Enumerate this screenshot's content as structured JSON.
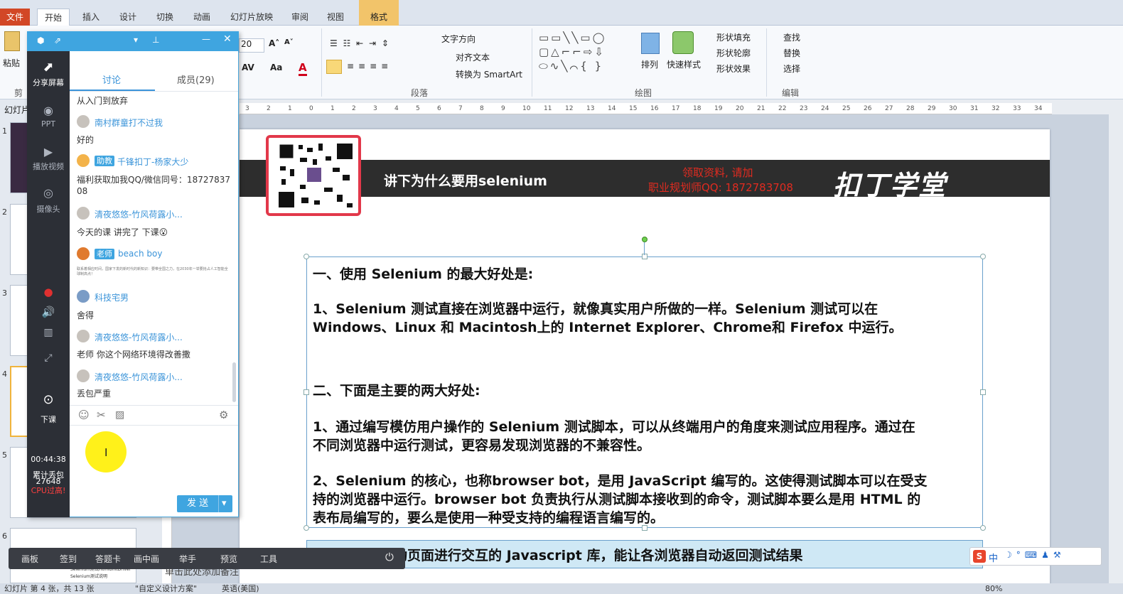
{
  "ribbon": {
    "file_tab": "文件",
    "tabs": [
      "开始",
      "插入",
      "设计",
      "切换",
      "动画",
      "幻灯片放映",
      "审阅",
      "视图"
    ],
    "context_tab": "格式",
    "groups": {
      "paste": "粘贴",
      "clipboard_short": "剪",
      "font_size": "20",
      "paragraph": "段落",
      "drawing": "绘图",
      "editing": "编辑"
    },
    "paragraph_items": [
      "文字方向",
      "对齐文本",
      "转换为 SmartArt"
    ],
    "drawing_items": [
      "排列",
      "快速样式"
    ],
    "shape_items": [
      "形状填充",
      "形状轮廓",
      "形状效果"
    ],
    "edit_items": [
      "查找",
      "替换",
      "选择"
    ]
  },
  "ruler": {
    "ticks": [
      "3",
      "2",
      "1",
      "0",
      "1",
      "2",
      "3",
      "4",
      "5",
      "6",
      "7",
      "8",
      "9",
      "10",
      "11",
      "12",
      "13",
      "14",
      "15",
      "16",
      "17",
      "18",
      "19",
      "20",
      "21",
      "22",
      "23",
      "24",
      "25",
      "26",
      "27",
      "28",
      "29",
      "30",
      "31",
      "32",
      "33",
      "34"
    ]
  },
  "slides_panel": {
    "label": "幻灯片",
    "numbers": [
      "1",
      "2",
      "3",
      "4",
      "5",
      "6"
    ],
    "thumb6_lines": [
      "Selenium测试HtmlUnitDriver",
      "Selenium测试说明"
    ]
  },
  "slide": {
    "banner_title": "讲下为什么要用selenium",
    "promo_line1": "领取资料, 请加",
    "promo_line2": "职业规划师QQ: 1872783708",
    "logo_text": "扣丁学堂",
    "lines": [
      "一、使用 Selenium 的最大好处是:",
      "1、Selenium 测试直接在浏览器中运行，就像真实用户所做的一样。Selenium  测试可以在",
      "Windows、Linux 和 Macintosh上的 Internet Explorer、Chrome和  Firefox 中运行。",
      "二、下面是主要的两大好处:",
      "1、通过编写模仿用户操作的  Selenium 测试脚本，可以从终端用户的角度来测试应用程序。通过在",
      "不同浏览器中运行测试，更容易发现浏览器的不兼容性。",
      "2、Selenium 的核心，也称browser  bot，是用 JavaScript 编写的。这使得测试脚本可以在受支",
      "持的浏览器中运行。browser  bot 负责执行从测试脚本接收到的命令，测试脚本要么是用  HTML 的",
      "表布局编写的，要么是使用一种受支持的编程语言编写的。"
    ],
    "bottom_line": "总概：可以驱动页面进行交互的  Javascript 库，能让各浏览器自动返回测试结果"
  },
  "chat": {
    "side_items": [
      "分享屏幕",
      "PPT",
      "播放视频",
      "摄像头",
      "下课"
    ],
    "timer": "00:44:38",
    "packet_label": "累计丢包",
    "packet_count": "27648",
    "cpu_warning": "CPU过高!",
    "tab_discuss": "讨论",
    "tab_members": "成员(29)",
    "messages": [
      {
        "text": "从入门到放弃"
      },
      {
        "name": "南村群童打不过我",
        "text": "好的"
      },
      {
        "role": "助教",
        "name": "千锋扣丁-杨家大少",
        "text": "福利获取加我QQ/微信同号：18727837",
        "text2": "08"
      },
      {
        "name": "清夜悠悠-竹风荷露小...",
        "text": "今天的课 讲完了 下课😮"
      },
      {
        "role": "老师",
        "name": "beach boy",
        "text": "联系着相应时间，国家下发的新时代的新知识：要带全国之力，在2030年一举要抢占人工智能全球制高点！"
      },
      {
        "name": "科技宅男",
        "text": "舍得"
      },
      {
        "name": "清夜悠悠-竹风荷露小...",
        "text": "老师 你这个网络环境得改善撒"
      },
      {
        "name": "清夜悠悠-竹风荷露小...",
        "text": "丢包严重"
      }
    ],
    "send_label": "发 送"
  },
  "toolbar": [
    "画板",
    "签到",
    "答题卡",
    "画中画",
    "举手",
    "预览",
    "工具"
  ],
  "status": {
    "slide_info": "幻灯片 第 4 张，共 13 张",
    "theme": "\"自定义设计方案\"",
    "lang": "英语(美国)",
    "notes": "单击此处添加备注",
    "zoom": "80%"
  },
  "ime": {
    "label": "中"
  }
}
